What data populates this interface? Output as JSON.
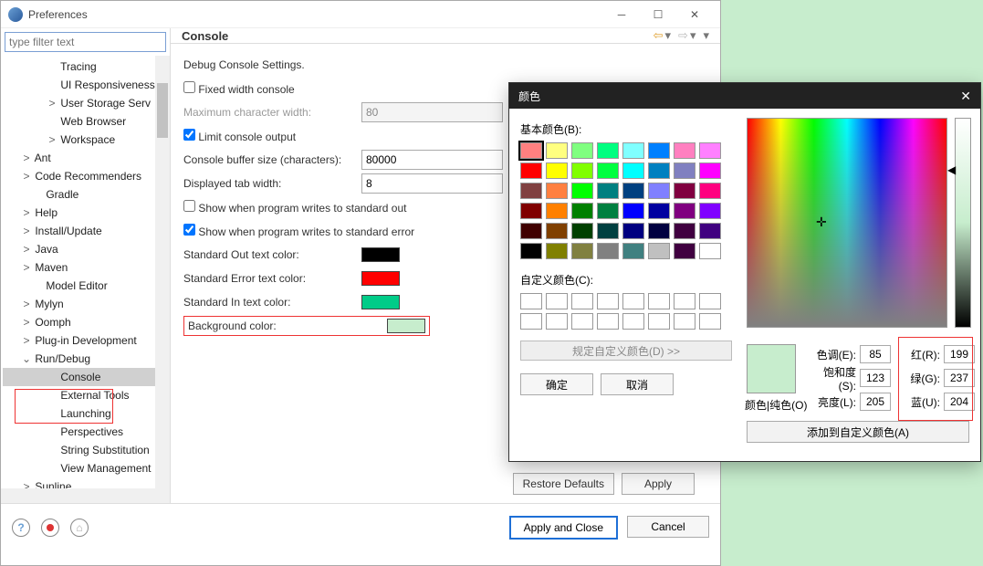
{
  "window": {
    "title": "Preferences"
  },
  "filter": {
    "placeholder": "type filter text"
  },
  "tree": {
    "items": [
      {
        "label": "Tracing",
        "indent": 48,
        "chev": ""
      },
      {
        "label": "UI Responsiveness",
        "indent": 48,
        "chev": ""
      },
      {
        "label": "User Storage Serv",
        "indent": 48,
        "chev": ">"
      },
      {
        "label": "Web Browser",
        "indent": 48,
        "chev": ""
      },
      {
        "label": "Workspace",
        "indent": 48,
        "chev": ">"
      },
      {
        "label": "Ant",
        "indent": 20,
        "chev": ">"
      },
      {
        "label": "Code Recommenders",
        "indent": 20,
        "chev": ">"
      },
      {
        "label": "Gradle",
        "indent": 32,
        "chev": ""
      },
      {
        "label": "Help",
        "indent": 20,
        "chev": ">"
      },
      {
        "label": "Install/Update",
        "indent": 20,
        "chev": ">"
      },
      {
        "label": "Java",
        "indent": 20,
        "chev": ">"
      },
      {
        "label": "Maven",
        "indent": 20,
        "chev": ">"
      },
      {
        "label": "Model Editor",
        "indent": 32,
        "chev": ""
      },
      {
        "label": "Mylyn",
        "indent": 20,
        "chev": ">"
      },
      {
        "label": "Oomph",
        "indent": 20,
        "chev": ">"
      },
      {
        "label": "Plug-in Development",
        "indent": 20,
        "chev": ">"
      },
      {
        "label": "Run/Debug",
        "indent": 20,
        "chev": "v"
      },
      {
        "label": "Console",
        "indent": 48,
        "chev": "",
        "sel": true
      },
      {
        "label": "External Tools",
        "indent": 48,
        "chev": ""
      },
      {
        "label": "Launching",
        "indent": 48,
        "chev": ""
      },
      {
        "label": "Perspectives",
        "indent": 48,
        "chev": ""
      },
      {
        "label": "String Substitution",
        "indent": 48,
        "chev": ""
      },
      {
        "label": "View Management",
        "indent": 48,
        "chev": ""
      },
      {
        "label": "Sunline",
        "indent": 20,
        "chev": ">"
      }
    ]
  },
  "page": {
    "title": "Console",
    "desc": "Debug Console Settings.",
    "fixed_width": "Fixed width console",
    "max_width_lbl": "Maximum character width:",
    "max_width_val": "80",
    "limit_output": "Limit console output",
    "buffer_lbl": "Console buffer size (characters):",
    "buffer_val": "80000",
    "tab_lbl": "Displayed tab width:",
    "tab_val": "8",
    "show_out": "Show when program writes to standard out",
    "show_err": "Show when program writes to standard error",
    "std_out": "Standard Out text color:",
    "std_err": "Standard Error text color:",
    "std_in": "Standard In text color:",
    "bg": "Background color:",
    "colors": {
      "out": "#000000",
      "err": "#ff0000",
      "in": "#00cc88",
      "bg": "#c7edcd"
    },
    "restore": "Restore Defaults",
    "apply": "Apply",
    "apply_close": "Apply and Close",
    "cancel": "Cancel"
  },
  "color_dialog": {
    "title": "颜色",
    "basic_lbl": "基本颜色(B):",
    "custom_lbl": "自定义颜色(C):",
    "define": "规定自定义颜色(D) >>",
    "ok": "确定",
    "cancel": "取消",
    "preview_lbl": "颜色|纯色(O)",
    "hue_lbl": "色调(E):",
    "sat_lbl": "饱和度(S):",
    "lum_lbl": "亮度(L):",
    "r_lbl": "红(R):",
    "g_lbl": "绿(G):",
    "b_lbl": "蓝(U):",
    "hue": "85",
    "sat": "123",
    "lum": "205",
    "r": "199",
    "g": "237",
    "b": "204",
    "add": "添加到自定义颜色(A)",
    "basic_colors": [
      "#ff8080",
      "#ffff80",
      "#80ff80",
      "#00ff80",
      "#80ffff",
      "#0080ff",
      "#ff80c0",
      "#ff80ff",
      "#ff0000",
      "#ffff00",
      "#80ff00",
      "#00ff40",
      "#00ffff",
      "#0080c0",
      "#8080c0",
      "#ff00ff",
      "#804040",
      "#ff8040",
      "#00ff00",
      "#008080",
      "#004080",
      "#8080ff",
      "#800040",
      "#ff0080",
      "#800000",
      "#ff8000",
      "#008000",
      "#008040",
      "#0000ff",
      "#0000a0",
      "#800080",
      "#8000ff",
      "#400000",
      "#804000",
      "#004000",
      "#004040",
      "#000080",
      "#000040",
      "#400040",
      "#400080",
      "#000000",
      "#808000",
      "#808040",
      "#808080",
      "#408080",
      "#c0c0c0",
      "#400040",
      "#ffffff"
    ]
  }
}
